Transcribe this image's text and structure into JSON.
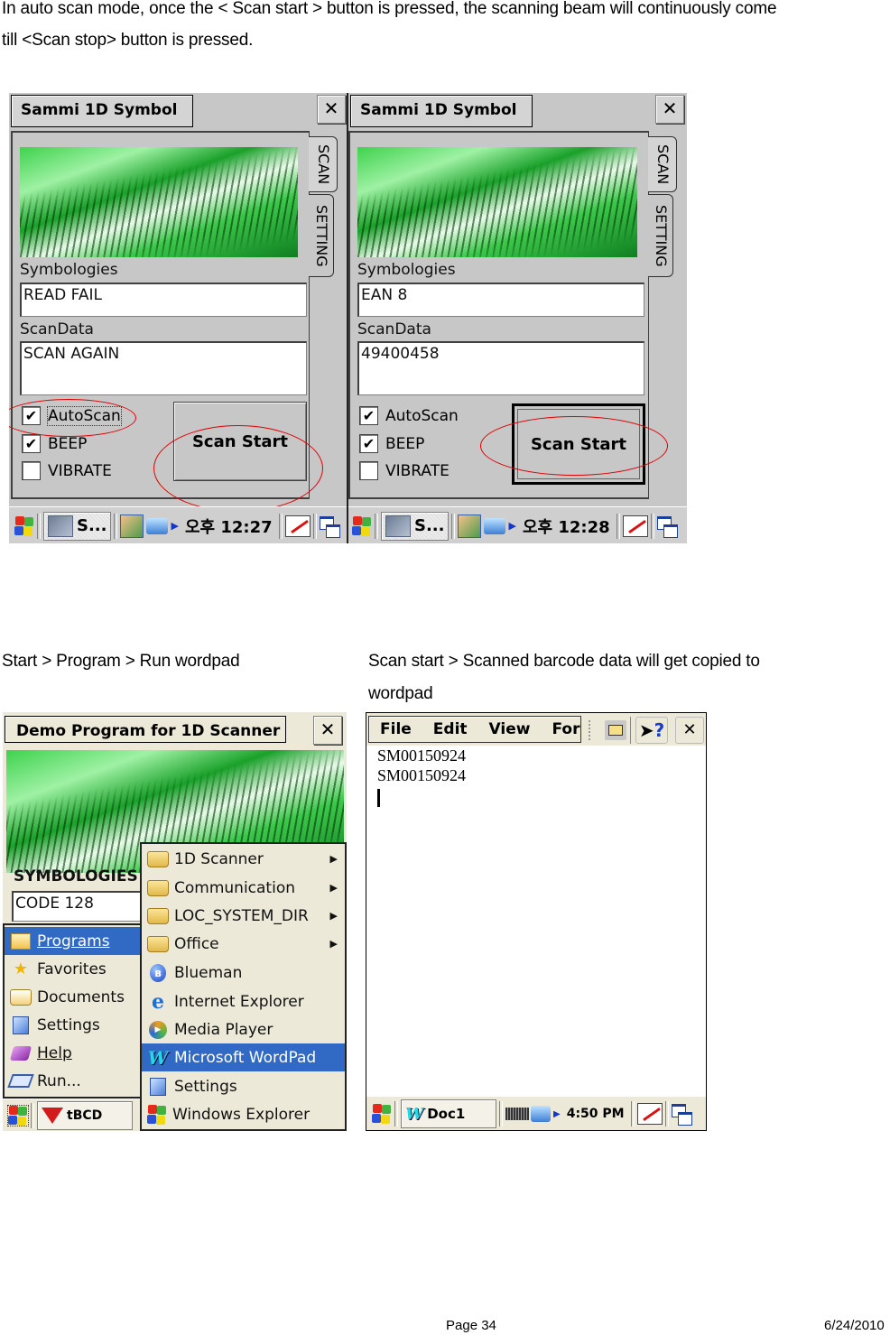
{
  "intro": {
    "line1": "In auto scan mode, once the < Scan start > button is pressed, the scanning beam will continuously come",
    "line2": "till <Scan stop> button is pressed."
  },
  "scan_screens": [
    {
      "title": "Sammi 1D Symbol",
      "close": "✕",
      "tabs": [
        "SCAN",
        "SETTING"
      ],
      "symbologies_label": "Symbologies",
      "symbologies_value": "READ FAIL",
      "scandata_label": "ScanData",
      "scandata_value": "SCAN AGAIN",
      "checkboxes": [
        {
          "label": "AutoScan",
          "checked": true
        },
        {
          "label": "BEEP",
          "checked": true
        },
        {
          "label": "VIBRATE",
          "checked": false
        }
      ],
      "scan_button": "Scan Start",
      "taskbar": {
        "task": "S...",
        "clock": "오후 12:27"
      }
    },
    {
      "title": "Sammi 1D Symbol",
      "close": "✕",
      "tabs": [
        "SCAN",
        "SETTING"
      ],
      "symbologies_label": "Symbologies",
      "symbologies_value": "EAN 8",
      "scandata_label": "ScanData",
      "scandata_value": "49400458",
      "checkboxes": [
        {
          "label": "AutoScan",
          "checked": true
        },
        {
          "label": "BEEP",
          "checked": true
        },
        {
          "label": "VIBRATE",
          "checked": false
        }
      ],
      "scan_button": "Scan Start",
      "taskbar": {
        "task": "S...",
        "clock": "오후 12:28"
      }
    }
  ],
  "caption_left": "Start > Program > Run wordpad",
  "caption_right": {
    "line1": "Scan start > Scanned barcode data will get copied to",
    "line2": "wordpad"
  },
  "demo_screen": {
    "title": "Demo Program for 1D Scanner",
    "close": "✕",
    "symbologies_label": "SYMBOLOGIES",
    "symbologies_value": "CODE 128",
    "start_menu": [
      {
        "label": "Programs",
        "icon": "programs-icon",
        "selected": true
      },
      {
        "label": "Favorites",
        "icon": "favorites-star-icon"
      },
      {
        "label": "Documents",
        "icon": "documents-icon"
      },
      {
        "label": "Settings",
        "icon": "settings-icon"
      },
      {
        "label": "Help",
        "icon": "help-book-icon"
      },
      {
        "label": "Run...",
        "icon": "run-icon"
      }
    ],
    "programs_menu": [
      {
        "label": "1D Scanner",
        "icon": "folder-icon",
        "submenu": true
      },
      {
        "label": "Communication",
        "icon": "folder-icon",
        "submenu": true
      },
      {
        "label": "LOC_SYSTEM_DIR",
        "icon": "folder-icon",
        "submenu": true
      },
      {
        "label": "Office",
        "icon": "folder-icon",
        "submenu": true
      },
      {
        "label": "Blueman",
        "icon": "bluetooth-icon"
      },
      {
        "label": "Internet Explorer",
        "icon": "internet-explorer-icon"
      },
      {
        "label": "Media Player",
        "icon": "media-player-icon"
      },
      {
        "label": "Microsoft WordPad",
        "icon": "wordpad-icon",
        "selected": true
      },
      {
        "label": "Settings",
        "icon": "settings-icon"
      },
      {
        "label": "Windows Explorer",
        "icon": "windows-explorer-icon"
      }
    ],
    "taskbar": {
      "task": "tBCD"
    }
  },
  "wordpad_screen": {
    "menu": [
      "File",
      "Edit",
      "View",
      "For"
    ],
    "lines": [
      "SM00150924",
      "SM00150924"
    ],
    "close": "✕",
    "help": "?",
    "taskbar": {
      "task": "Doc1",
      "clock": "4:50 PM"
    }
  },
  "footer": {
    "page": "Page 34",
    "date": "6/24/2010"
  },
  "colors": {
    "highlight_circle": "#e00000",
    "menu_selection": "#316ac5"
  }
}
